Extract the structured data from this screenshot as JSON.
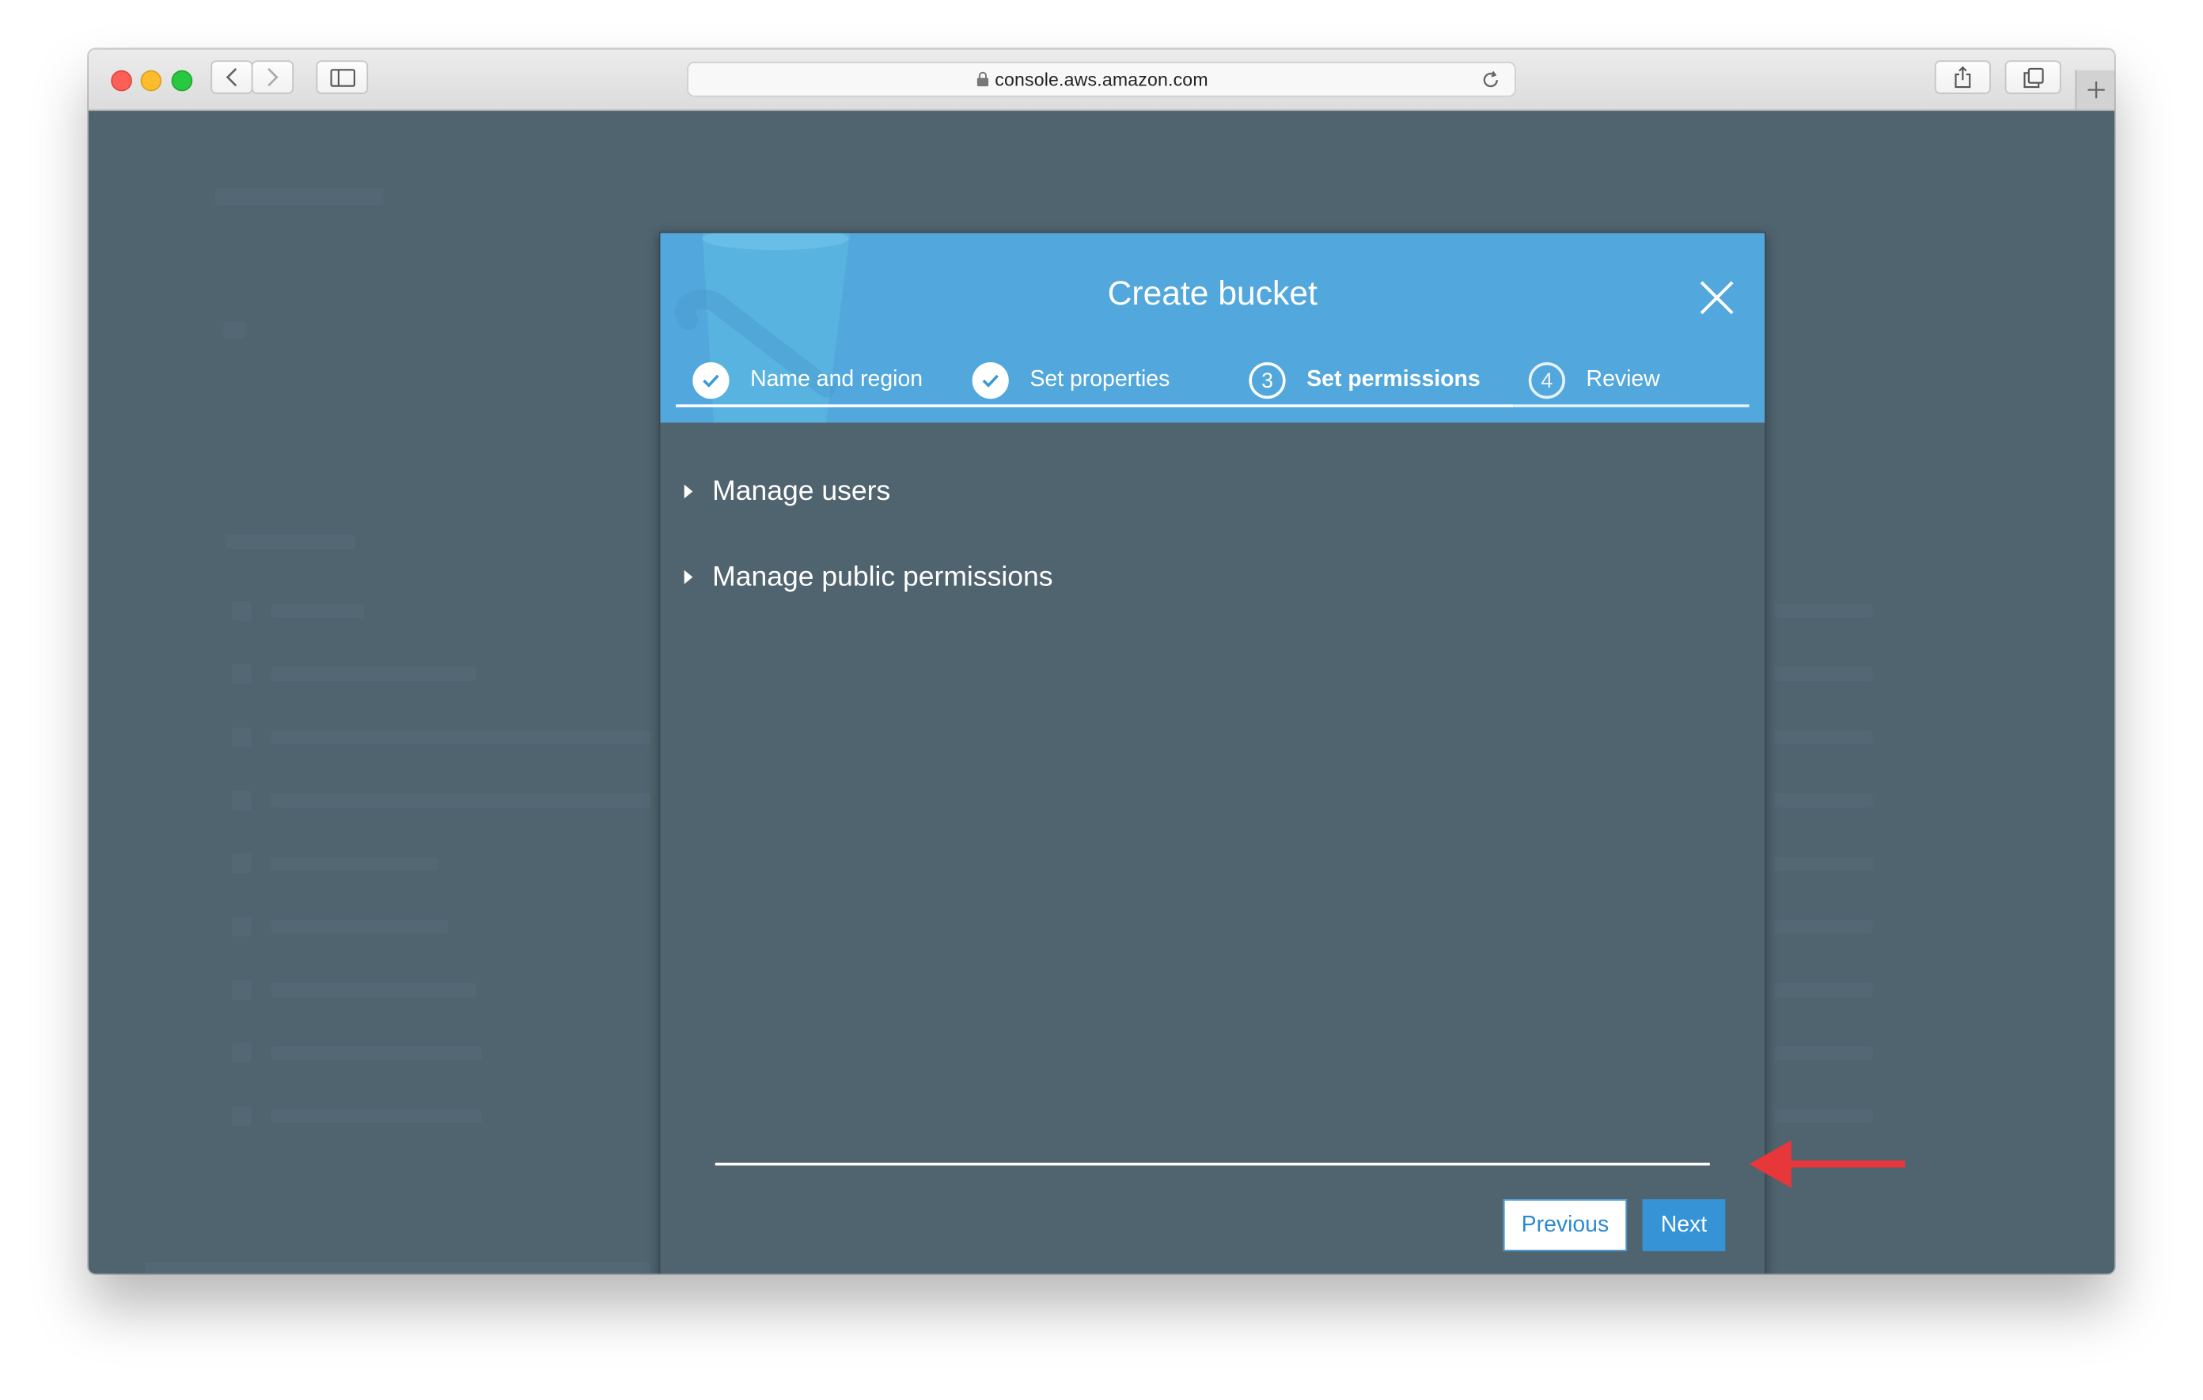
{
  "browser": {
    "url": "console.aws.amazon.com",
    "icons": {
      "back": "chevron-left-icon",
      "forward": "chevron-right-icon",
      "sidebar": "sidebar-icon",
      "lock": "lock-icon",
      "reload": "reload-icon",
      "share": "share-icon",
      "tabs": "tabs-icon",
      "new_tab": "plus-icon"
    }
  },
  "modal": {
    "title": "Create bucket",
    "steps": [
      {
        "number": "1",
        "label": "Name and region",
        "state": "done"
      },
      {
        "number": "2",
        "label": "Set properties",
        "state": "done"
      },
      {
        "number": "3",
        "label": "Set permissions",
        "state": "active"
      },
      {
        "number": "4",
        "label": "Review",
        "state": "pending"
      }
    ],
    "sections": [
      {
        "label": "Manage users",
        "expanded": false
      },
      {
        "label": "Manage public permissions",
        "expanded": false
      }
    ],
    "buttons": {
      "previous": "Previous",
      "next": "Next"
    }
  },
  "annotation": {
    "arrow_color": "#e8373a",
    "points_to": "next"
  },
  "colors": {
    "header_blue": "#52a7dc",
    "overlay_slate": "#50646f",
    "button_blue": "#3593d6"
  }
}
